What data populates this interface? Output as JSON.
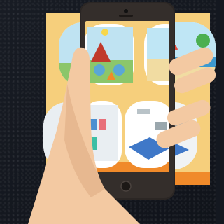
{
  "scene": {
    "poster_color": "#f6cf7c",
    "accent_orange": "#f08a2a",
    "phone_color": "#2b2624",
    "skin_color": "#f3c9a2",
    "tiles": [
      {
        "icon": "camping-scene-icon"
      },
      {
        "icon": "beach-scene-icon"
      },
      {
        "icon": "shop-scene-icon"
      },
      {
        "icon": "bedroom-scene-icon"
      }
    ]
  }
}
